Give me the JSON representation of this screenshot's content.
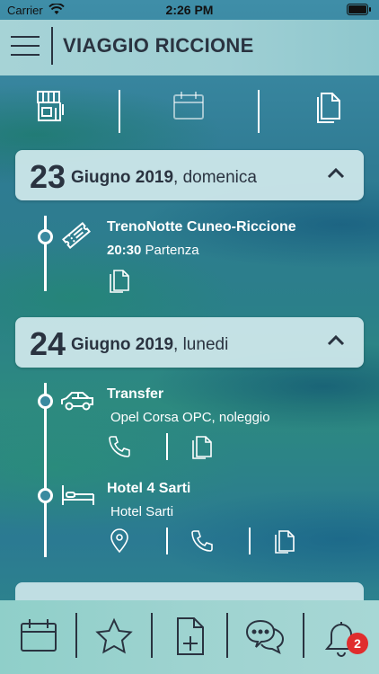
{
  "status_bar": {
    "carrier": "Carrier",
    "time": "2:26 PM"
  },
  "header": {
    "title": "VIAGGIO RICCIONE"
  },
  "toolbar": {
    "icons": [
      "shop-icon",
      "calendar-icon",
      "documents-icon"
    ]
  },
  "days": [
    {
      "day": "23",
      "month_year": "Giugno 2019",
      "weekday": ", domenica",
      "events": [
        {
          "title": "TrenoNotte Cuneo-Riccione",
          "time": "20:30",
          "detail": " Partenza",
          "icon": "ticket-icon",
          "actions": [
            "document-icon"
          ]
        }
      ]
    },
    {
      "day": "24",
      "month_year": "Giugno 2019",
      "weekday": ", lunedi",
      "events": [
        {
          "title": "Transfer",
          "detail": "Opel Corsa OPC, noleggio",
          "icon": "car-icon",
          "actions": [
            "phone-icon",
            "document-icon"
          ]
        },
        {
          "title": "Hotel 4 Sarti",
          "detail": "Hotel Sarti",
          "icon": "bed-icon",
          "actions": [
            "location-pin-icon",
            "phone-icon",
            "document-icon"
          ]
        }
      ]
    }
  ],
  "tabbar": {
    "tabs": [
      "calendar-tab",
      "favorites-tab",
      "add-document-tab",
      "chat-tab",
      "notifications-tab"
    ],
    "notification_badge": "2"
  },
  "colors": {
    "text_dark": "#2a3340",
    "badge_red": "#e02d2d",
    "line_white": "#ffffff"
  }
}
